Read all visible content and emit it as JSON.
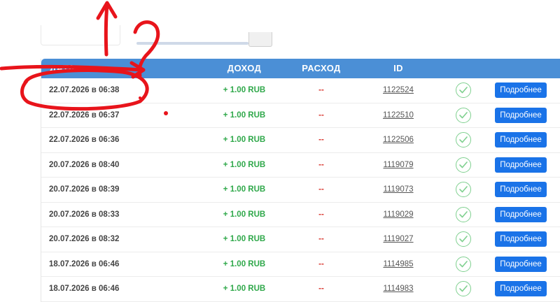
{
  "header": {
    "date": "ДАТА",
    "income": "ДОХОД",
    "expense": "РАСХОД",
    "id": "ID"
  },
  "rows": [
    {
      "date": "22.07.2026 в 06:38",
      "income": "+ 1.00 RUB",
      "expense": "--",
      "id": "1122524",
      "action": "Подробнее"
    },
    {
      "date": "22.07.2026 в 06:37",
      "income": "+ 1.00 RUB",
      "expense": "--",
      "id": "1122510",
      "action": "Подробнее"
    },
    {
      "date": "22.07.2026 в 06:36",
      "income": "+ 1.00 RUB",
      "expense": "--",
      "id": "1122506",
      "action": "Подробнее"
    },
    {
      "date": "20.07.2026 в 08:40",
      "income": "+ 1.00 RUB",
      "expense": "--",
      "id": "1119079",
      "action": "Подробнее"
    },
    {
      "date": "20.07.2026 в 08:39",
      "income": "+ 1.00 RUB",
      "expense": "--",
      "id": "1119073",
      "action": "Подробнее"
    },
    {
      "date": "20.07.2026 в 08:33",
      "income": "+ 1.00 RUB",
      "expense": "--",
      "id": "1119029",
      "action": "Подробнее"
    },
    {
      "date": "20.07.2026 в 08:32",
      "income": "+ 1.00 RUB",
      "expense": "--",
      "id": "1119027",
      "action": "Подробнее"
    },
    {
      "date": "18.07.2026 в 06:46",
      "income": "+ 1.00 RUB",
      "expense": "--",
      "id": "1114985",
      "action": "Подробнее"
    },
    {
      "date": "18.07.2026 в 06:46",
      "income": "+ 1.00 RUB",
      "expense": "--",
      "id": "1114983",
      "action": "Подробнее"
    }
  ],
  "icons": {
    "status": "check-circle-icon"
  },
  "colors": {
    "header_bg": "#4b8fd6",
    "income": "#2fa84a",
    "expense": "#d9372f",
    "button": "#1a73e8",
    "annotation": "#e8141b"
  }
}
